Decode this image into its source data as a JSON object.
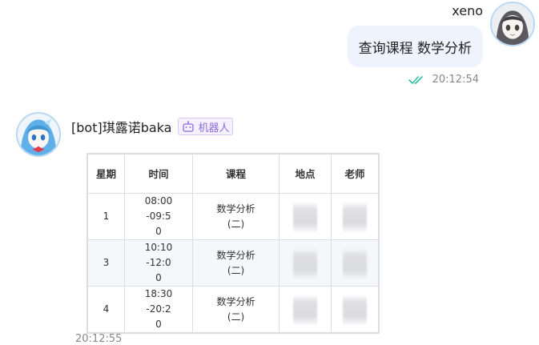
{
  "user_message": {
    "sender": "xeno",
    "text": "查询课程 数学分析",
    "time": "20:12:54",
    "read_icon": "double-check-icon",
    "read_color": "#35c0a4"
  },
  "bot_message": {
    "sender": "[bot]琪露诺baka",
    "badge": "机器人",
    "badge_icon": "robot-icon",
    "badge_color": "#8a6bd8",
    "time": "20:12:55",
    "table": {
      "headers": [
        "星期",
        "时间",
        "课程",
        "地点",
        "老师"
      ],
      "rows": [
        {
          "day": "1",
          "time": "08:00-09:50",
          "course": "数学分析(二)",
          "location": "",
          "teacher": ""
        },
        {
          "day": "3",
          "time": "10:10-12:00",
          "course": "数学分析(二)",
          "location": "",
          "teacher": ""
        },
        {
          "day": "4",
          "time": "18:30-20:20",
          "course": "数学分析(二)",
          "location": "",
          "teacher": ""
        }
      ]
    }
  }
}
